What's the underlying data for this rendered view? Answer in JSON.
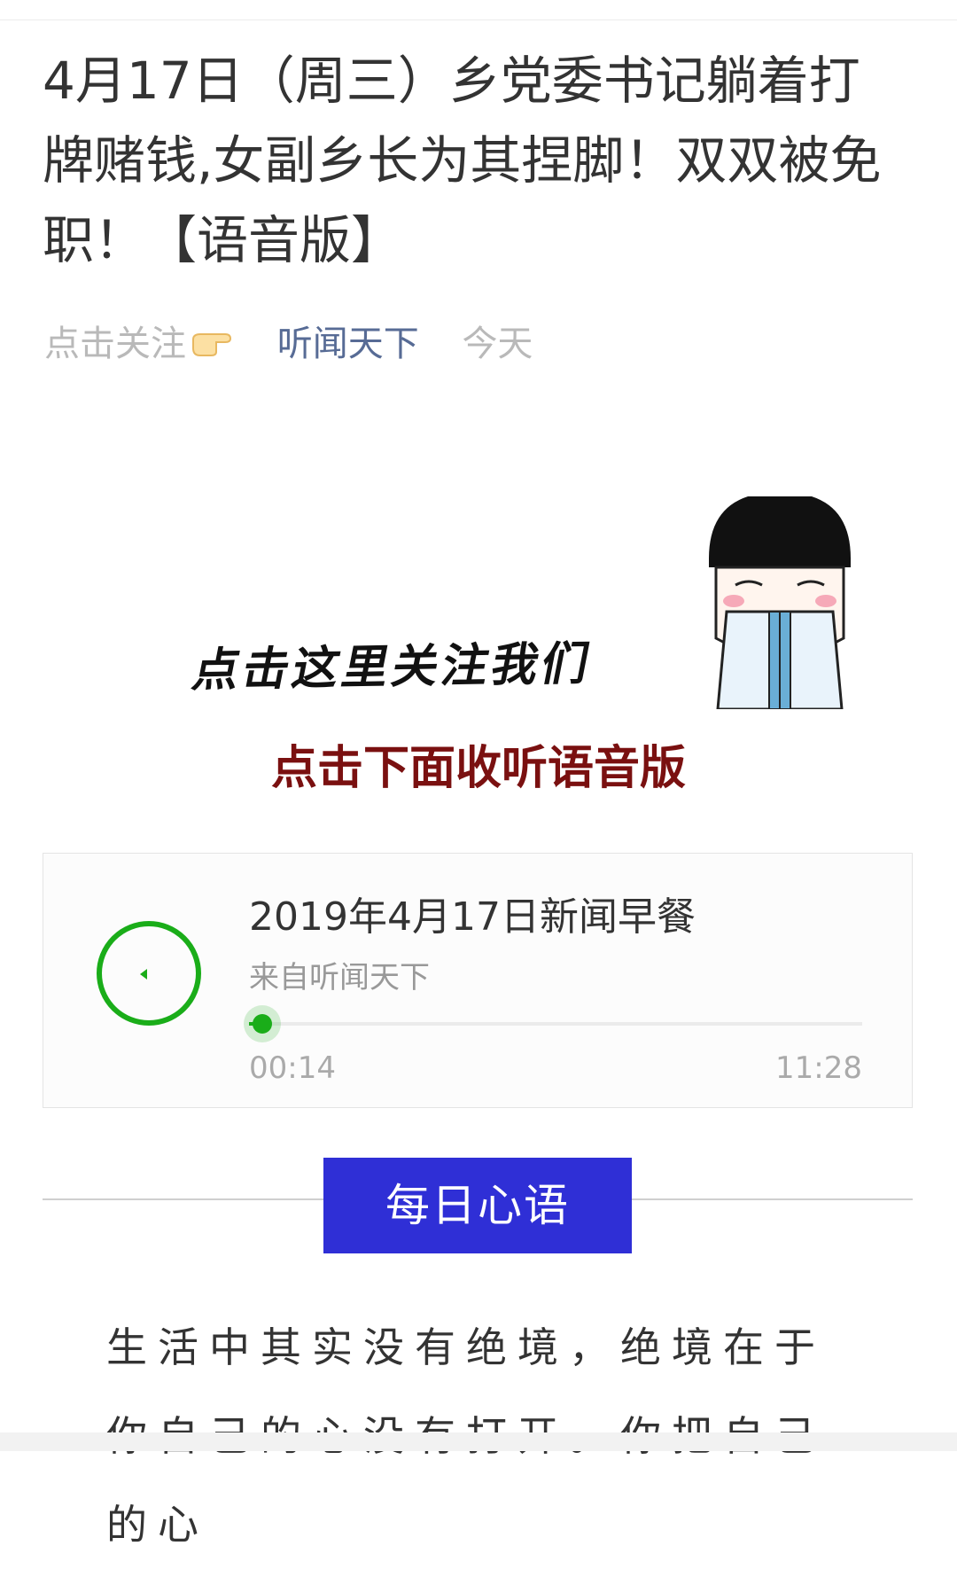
{
  "article": {
    "title": "4月17日（周三）乡党委书记躺着打牌赌钱,女副乡长为其捏脚！双双被免职！【语音版】",
    "follow_label": "点击关注",
    "author": "听闻天下",
    "date": "今天"
  },
  "banner": {
    "text": "点击这里关注我们"
  },
  "listen_hint": "点击下面收听语音版",
  "audio": {
    "title": "2019年4月17日新闻早餐",
    "source": "来自听闻天下",
    "current_time": "00:14",
    "total_time": "11:28",
    "progress": 0.021,
    "accent_color": "#1aad19"
  },
  "section": {
    "title": "每日心语",
    "color": "#2f2fd6"
  },
  "body_text": "生活中其实没有绝境，绝境在于你自己的心没有打开。你把自己的心"
}
